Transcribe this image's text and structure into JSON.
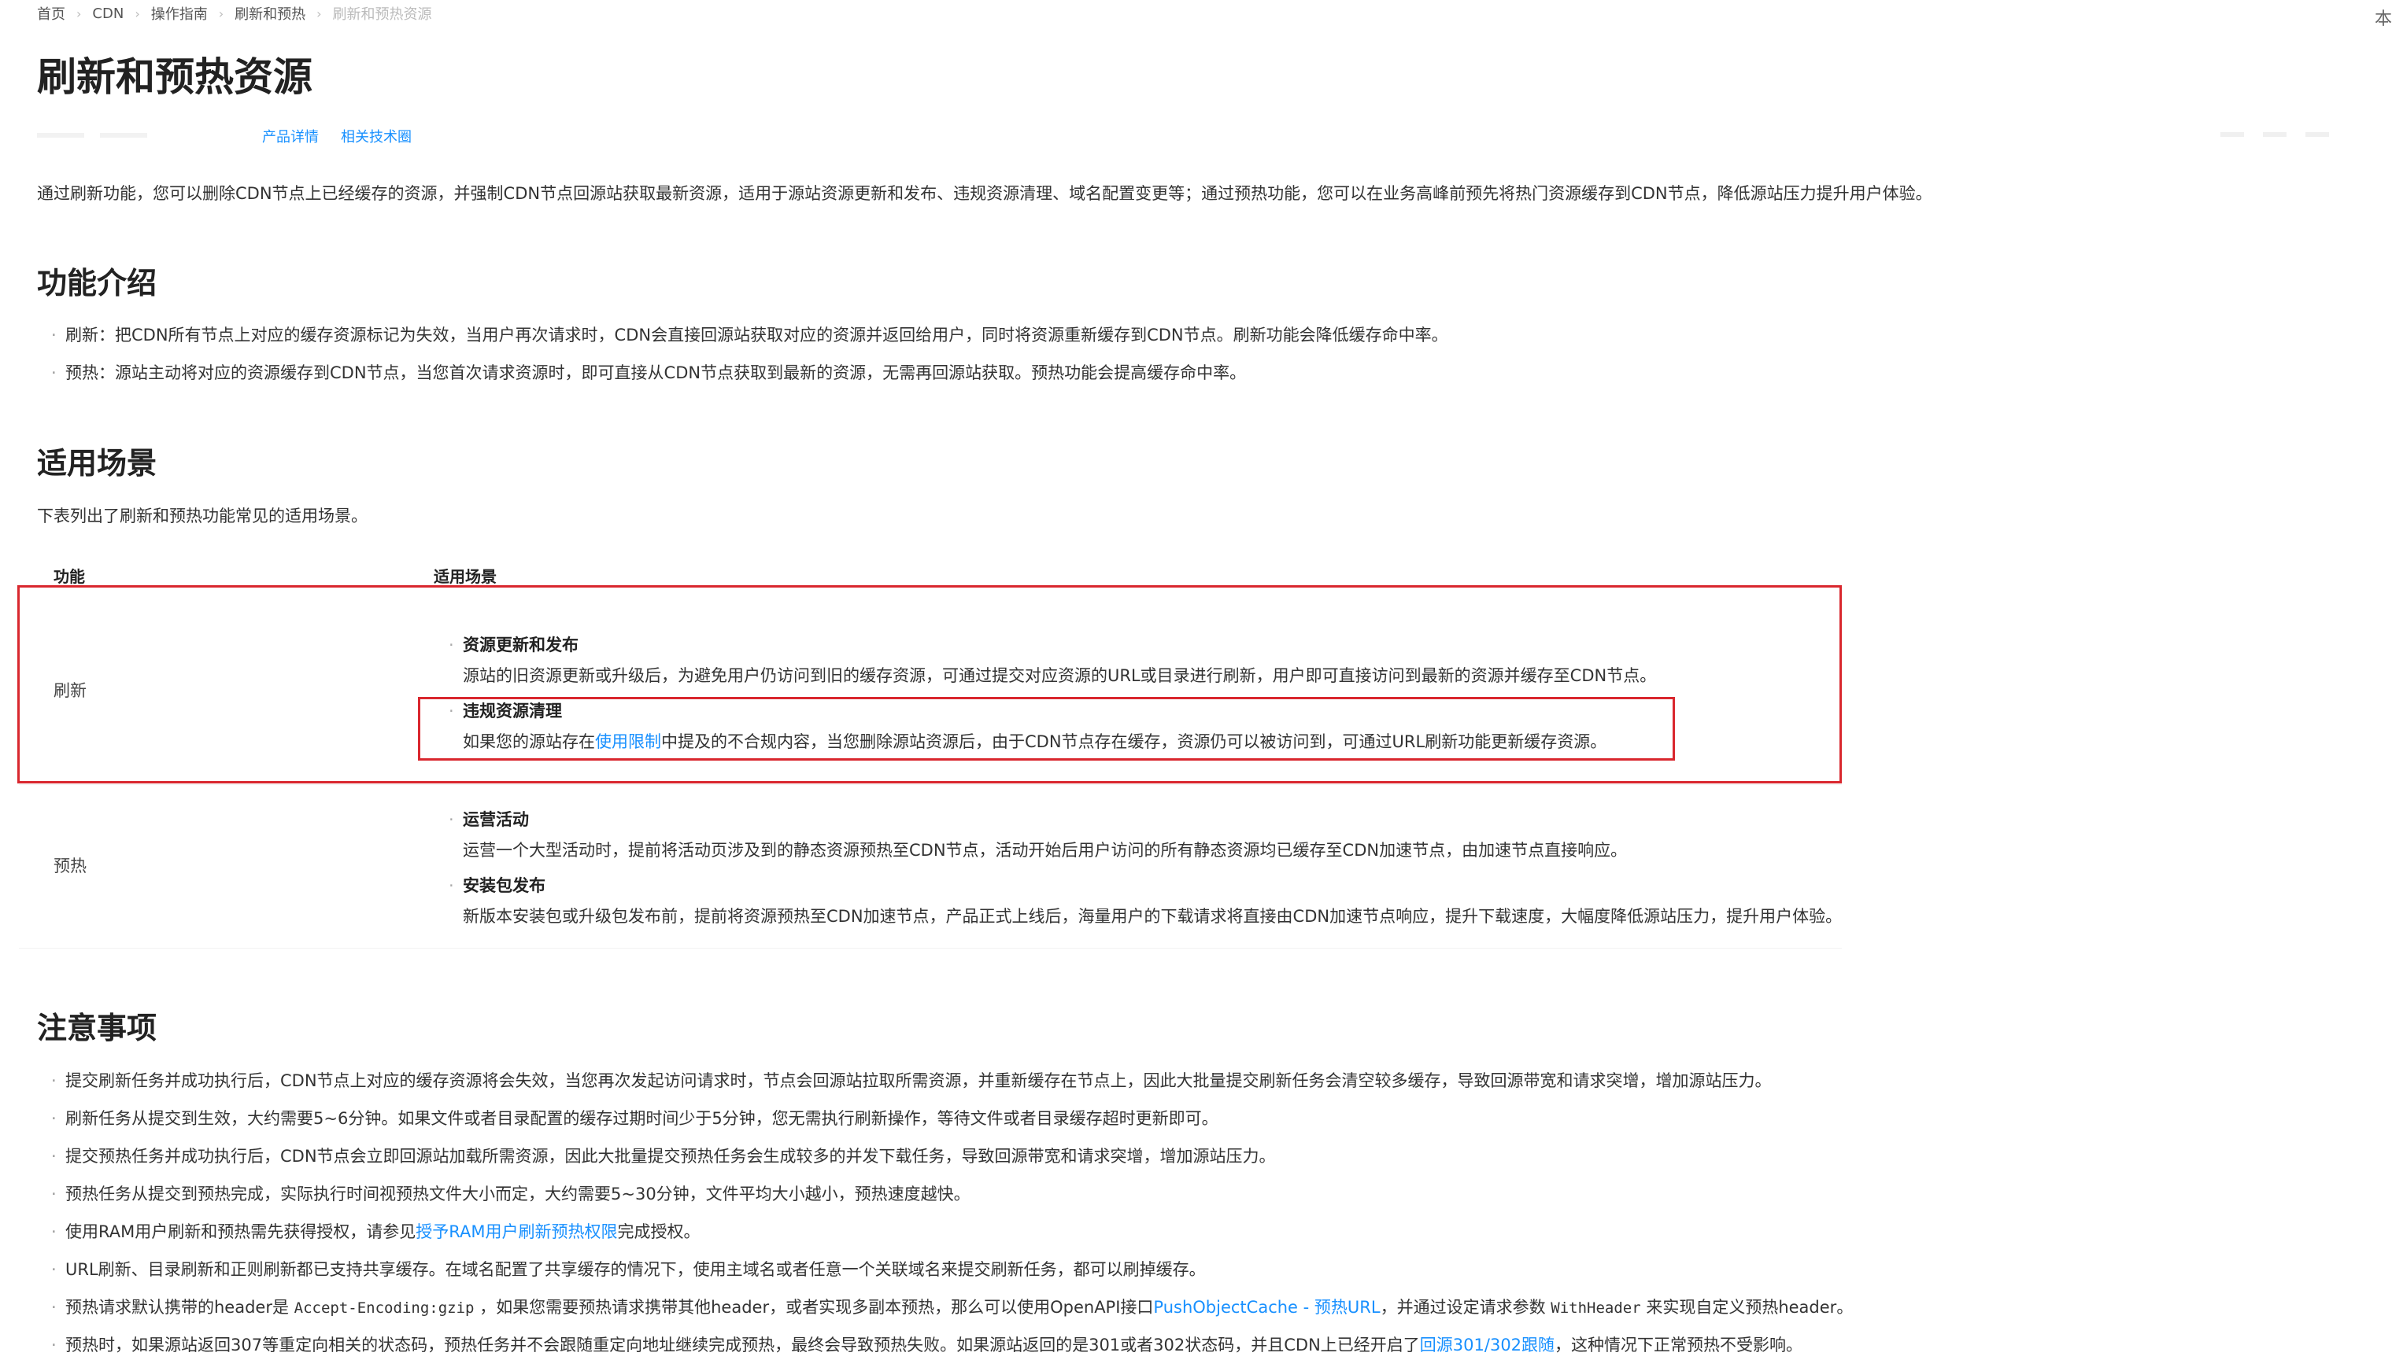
{
  "breadcrumb": {
    "items": [
      "首页",
      "CDN",
      "操作指南",
      "刷新和预热",
      "刷新和预热资源"
    ],
    "separator": "›"
  },
  "corner_glyph": "本",
  "page_title": "刷新和预热资源",
  "meta_links": [
    "产品详情",
    "相关技术圈"
  ],
  "intro": "通过刷新功能，您可以删除CDN节点上已经缓存的资源，并强制CDN节点回源站获取最新资源，适用于源站资源更新和发布、违规资源清理、域名配置变更等；通过预热功能，您可以在业务高峰前预先将热门资源缓存到CDN节点，降低源站压力提升用户体验。",
  "section_function": {
    "title": "功能介绍",
    "items": [
      "刷新：把CDN所有节点上对应的缓存资源标记为失效，当用户再次请求时，CDN会直接回源站获取对应的资源并返回给用户，同时将资源重新缓存到CDN节点。刷新功能会降低缓存命中率。",
      "预热：源站主动将对应的资源缓存到CDN节点，当您首次请求资源时，即可直接从CDN节点获取到最新的资源，无需再回源站获取。预热功能会提高缓存命中率。"
    ]
  },
  "section_scene": {
    "title": "适用场景",
    "desc": "下表列出了刷新和预热功能常见的适用场景。",
    "table": {
      "headers": [
        "功能",
        "适用场景"
      ],
      "rows": [
        {
          "label": "刷新",
          "scenes": [
            {
              "title": "资源更新和发布",
              "desc": "源站的旧资源更新或升级后，为避免用户仍访问到旧的缓存资源，可通过提交对应资源的URL或目录进行刷新，用户即可直接访问到最新的资源并缓存至CDN节点。"
            },
            {
              "title": "违规资源清理",
              "desc_pre": "如果您的源站存在",
              "desc_link": "使用限制",
              "desc_post": "中提及的不合规内容，当您删除源站资源后，由于CDN节点存在缓存，资源仍可以被访问到，可通过URL刷新功能更新缓存资源。"
            }
          ]
        },
        {
          "label": "预热",
          "scenes": [
            {
              "title": "运营活动",
              "desc": "运营一个大型活动时，提前将活动页涉及到的静态资源预热至CDN节点，活动开始后用户访问的所有静态资源均已缓存至CDN加速节点，由加速节点直接响应。"
            },
            {
              "title": "安装包发布",
              "desc": "新版本安装包或升级包发布前，提前将资源预热至CDN加速节点，产品正式上线后，海量用户的下载请求将直接由CDN加速节点响应，提升下载速度，大幅度降低源站压力，提升用户体验。"
            }
          ]
        }
      ]
    }
  },
  "section_notes": {
    "title": "注意事项",
    "items": [
      {
        "text": "提交刷新任务并成功执行后，CDN节点上对应的缓存资源将会失效，当您再次发起访问请求时，节点会回源站拉取所需资源，并重新缓存在节点上，因此大批量提交刷新任务会清空较多缓存，导致回源带宽和请求突增，增加源站压力。"
      },
      {
        "text": "刷新任务从提交到生效，大约需要5~6分钟。如果文件或者目录配置的缓存过期时间少于5分钟，您无需执行刷新操作，等待文件或者目录缓存超时更新即可。"
      },
      {
        "text": "提交预热任务并成功执行后，CDN节点会立即回源站加载所需资源，因此大批量提交预热任务会生成较多的并发下载任务，导致回源带宽和请求突增，增加源站压力。"
      },
      {
        "text": "预热任务从提交到预热完成，实际执行时间视预热文件大小而定，大约需要5~30分钟，文件平均大小越小，预热速度越快。"
      },
      {
        "pre": "使用RAM用户刷新和预热需先获得授权，请参见",
        "link": "授予RAM用户刷新预热权限",
        "post": "完成授权。"
      },
      {
        "text": "URL刷新、目录刷新和正则刷新都已支持共享缓存。在域名配置了共享缓存的情况下，使用主域名或者任意一个关联域名来提交刷新任务，都可以刷掉缓存。"
      },
      {
        "pre": "预热请求默认携带的header是 ",
        "code": "Accept-Encoding:gzip",
        "mid": " ，如果您需要预热请求携带其他header，或者实现多副本预热，那么可以使用OpenAPI接口",
        "link": "PushObjectCache - 预热URL",
        "mid2": "，并通过设定请求参数 ",
        "code2": "WithHeader",
        "post": " 来实现自定义预热header。"
      },
      {
        "pre": "预热时，如果源站返回307等重定向相关的状态码，预热任务并不会跟随重定向地址继续完成预热，最终会导致预热失败。如果源站返回的是301或者302状态码，并且CDN上已经开启了",
        "link": "回源301/302跟随",
        "post": "，这种情况下正常预热不受影响。"
      }
    ]
  },
  "colors": {
    "link": "#1890ff",
    "annotation_red": "#d9272e"
  }
}
